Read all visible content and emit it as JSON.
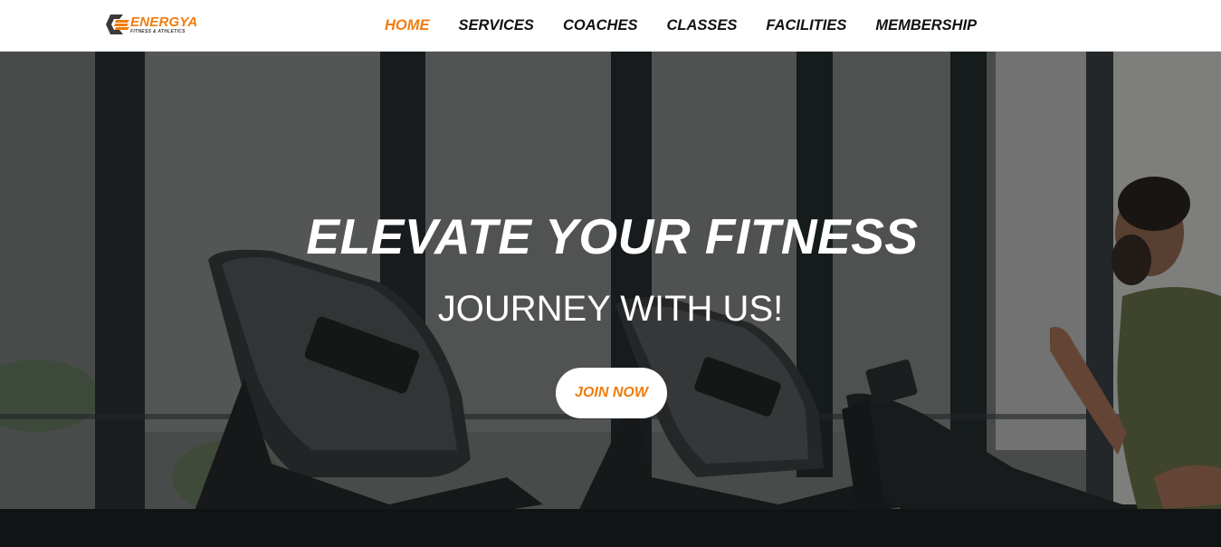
{
  "brand": {
    "name": "ENERGYA",
    "tagline": "FITNESS & ATHLETICS",
    "accent_color": "#f07c0e",
    "logo_icon": "energya-logo-icon"
  },
  "nav": {
    "items": [
      {
        "label": "HOME",
        "active": true
      },
      {
        "label": "SERVICES",
        "active": false
      },
      {
        "label": "COACHES",
        "active": false
      },
      {
        "label": "CLASSES",
        "active": false
      },
      {
        "label": "FACILITIES",
        "active": false
      },
      {
        "label": "MEMBERSHIP",
        "active": false
      }
    ]
  },
  "hero": {
    "title": "ELEVATE YOUR FITNESS",
    "subtitle": "JOURNEY WITH US!",
    "cta_label": "JOIN NOW"
  }
}
